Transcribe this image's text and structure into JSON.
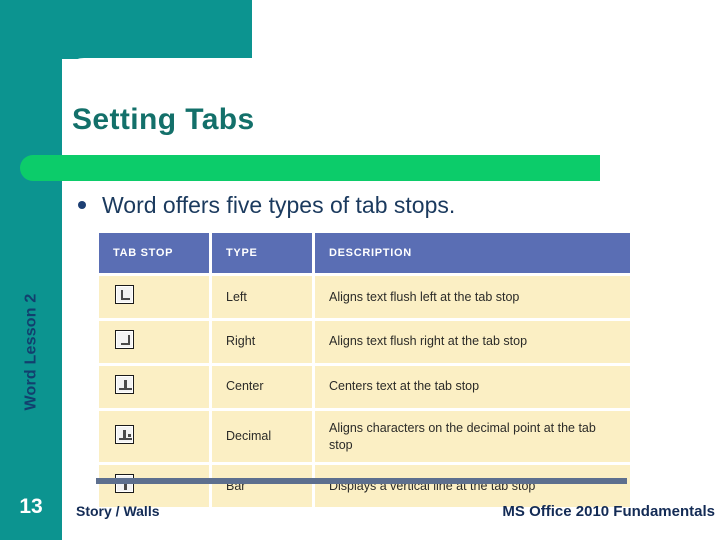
{
  "slide": {
    "title": "Setting Tabs",
    "sidebar_label": "Word Lesson 2",
    "bullet_text": "Word offers five types of tab stops."
  },
  "colors": {
    "teal": "#0c9490",
    "green_bar": "#0ccc6a",
    "title_teal": "#13706a",
    "header_blue": "#5a6eb4",
    "cell_cream": "#fbefc4",
    "underline_blue": "#5d6f8e",
    "text_navy": "#132b55"
  },
  "table": {
    "headers": [
      "TAB STOP",
      "TYPE",
      "DESCRIPTION"
    ],
    "rows": [
      {
        "icon": "left-tab-stop-icon",
        "type": "Left",
        "description": "Aligns text flush left at the tab stop"
      },
      {
        "icon": "right-tab-stop-icon",
        "type": "Right",
        "description": "Aligns text flush right at the tab stop"
      },
      {
        "icon": "center-tab-stop-icon",
        "type": "Center",
        "description": "Centers text at the tab stop"
      },
      {
        "icon": "decimal-tab-stop-icon",
        "type": "Decimal",
        "description": "Aligns characters on the decimal point at the tab stop"
      },
      {
        "icon": "bar-tab-stop-icon",
        "type": "Bar",
        "description": "Displays a vertical line at the tab stop"
      }
    ]
  },
  "footer": {
    "page_number": "13",
    "left_text": "Story / Walls",
    "right_text": "MS Office 2010 Fundamentals"
  }
}
